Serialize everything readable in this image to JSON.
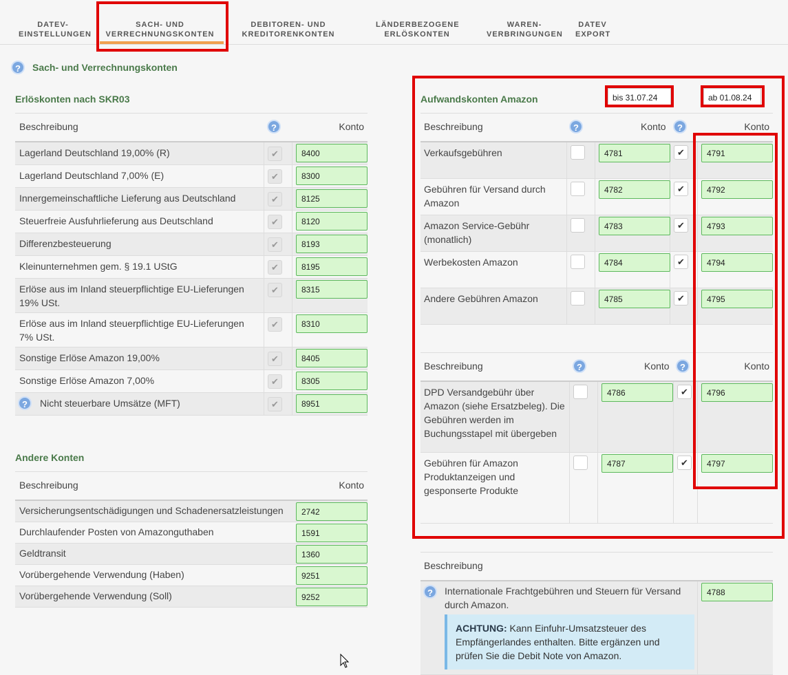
{
  "tabs": [
    {
      "label": "DATEV-\nEINSTELLUNGEN"
    },
    {
      "label": "SACH- UND\nVERRECHNUNGSKONTEN"
    },
    {
      "label": "DEBITOREN- UND\nKREDITORENKONTEN"
    },
    {
      "label": "LÄNDERBEZOGENE\nERLÖSKONTEN"
    },
    {
      "label": "WAREN-\nVERBRINGUNGEN"
    },
    {
      "label": "DATEV\nEXPORT"
    }
  ],
  "page_title": "Sach- und Verrechnungskonten",
  "erloes": {
    "title": "Erlöskonten nach SKR03",
    "col_desc": "Beschreibung",
    "col_konto": "Konto",
    "rows": [
      {
        "desc": "Lagerland Deutschland 19,00% (R)",
        "konto": "8400"
      },
      {
        "desc": "Lagerland Deutschland 7,00% (E)",
        "konto": "8300"
      },
      {
        "desc": "Innergemeinschaftliche Lieferung aus Deutschland",
        "konto": "8125"
      },
      {
        "desc": "Steuerfreie Ausfuhrlieferung aus Deutschland",
        "konto": "8120"
      },
      {
        "desc": "Differenzbesteuerung",
        "konto": "8193"
      },
      {
        "desc": "Kleinunternehmen gem. § 19.1 UStG",
        "konto": "8195"
      },
      {
        "desc": "Erlöse aus im Inland steuerpflichtige EU-Lieferungen 19% USt.",
        "konto": "8315"
      },
      {
        "desc": "Erlöse aus im Inland steuerpflichtige EU-Lieferungen 7% USt.",
        "konto": "8310"
      },
      {
        "desc": "Sonstige Erlöse Amazon 19,00%",
        "konto": "8405"
      },
      {
        "desc": "Sonstige Erlöse Amazon 7,00%",
        "konto": "8305"
      },
      {
        "desc": "Nicht steuerbare Umsätze (MFT)",
        "konto": "8951"
      }
    ]
  },
  "andere": {
    "title": "Andere Konten",
    "col_desc": "Beschreibung",
    "col_konto": "Konto",
    "rows": [
      {
        "desc": "Versicherungsentschädigungen und Schadenersatzleistungen",
        "konto": "2742"
      },
      {
        "desc": "Durchlaufender Posten von Amazonguthaben",
        "konto": "1591"
      },
      {
        "desc": "Geldtransit",
        "konto": "1360"
      },
      {
        "desc": "Vorübergehende Verwendung (Haben)",
        "konto": "9251"
      },
      {
        "desc": "Vorübergehende Verwendung (Soll)",
        "konto": "9252"
      }
    ]
  },
  "aufwand": {
    "title": "Aufwandskonten Amazon",
    "date_before": "bis 31.07.24",
    "date_after": "ab 01.08.24",
    "col_desc": "Beschreibung",
    "col_konto": "Konto",
    "rows": [
      {
        "desc": "Verkaufsgebühren",
        "konto_old": "4781",
        "konto_new": "4791"
      },
      {
        "desc": "Gebühren für Versand durch Amazon",
        "konto_old": "4782",
        "konto_new": "4792"
      },
      {
        "desc": "Amazon Service-Gebühr (monatlich)",
        "konto_old": "4783",
        "konto_new": "4793"
      },
      {
        "desc": "Werbekosten Amazon",
        "konto_old": "4784",
        "konto_new": "4794"
      },
      {
        "desc": "Andere Gebühren Amazon",
        "konto_old": "4785",
        "konto_new": "4795"
      }
    ],
    "rows2": [
      {
        "desc": "DPD Versandgebühr über Amazon (siehe Ersatzbeleg). Die Gebühren werden im Buchungsstapel mit übergeben",
        "konto_old": "4786",
        "konto_new": "4796"
      },
      {
        "desc": "Gebühren für Amazon Produktanzeigen und gesponserte Produkte",
        "konto_old": "4787",
        "konto_new": "4797"
      }
    ]
  },
  "fracht": {
    "col_desc": "Beschreibung",
    "desc": "Internationale Frachtgebühren und Steuern für Versand durch Amazon.",
    "konto": "4788",
    "notice_strong": "ACHTUNG:",
    "notice_text": " Kann Einfuhr-Umsatzsteuer des Empfängerlandes enthalten. Bitte ergänzen und prüfen Sie die Debit Note von Amazon."
  },
  "check_mark": "✔",
  "help_mark": "?"
}
